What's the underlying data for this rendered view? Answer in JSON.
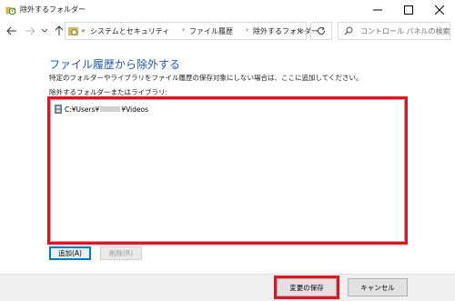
{
  "window": {
    "title": "除外するフォルダー",
    "icon": "file-history-icon"
  },
  "nav": {
    "overflow": "«",
    "breadcrumb": [
      "システムとセキュリティ",
      "ファイル履歴",
      "除外するフォルダー"
    ],
    "search_placeholder": "コントロール パネルの検索"
  },
  "content": {
    "heading": "ファイル履歴から除外する",
    "description": "特定のフォルダーやライブラリをファイル履歴の保存対象にしない場合は、ここに追加してください。",
    "list_label": "除外するフォルダーまたはライブラリ:",
    "items": [
      {
        "prefix": "C:¥Users¥",
        "suffix": "¥Videos"
      }
    ],
    "add_button": "追加(A)",
    "delete_button": "削除(R)"
  },
  "footer": {
    "save_button": "変更の保存",
    "cancel_button": "キャンセル"
  },
  "colors": {
    "highlight": "#e0141e",
    "heading": "#1e5aa8",
    "accent": "#0078d7"
  }
}
